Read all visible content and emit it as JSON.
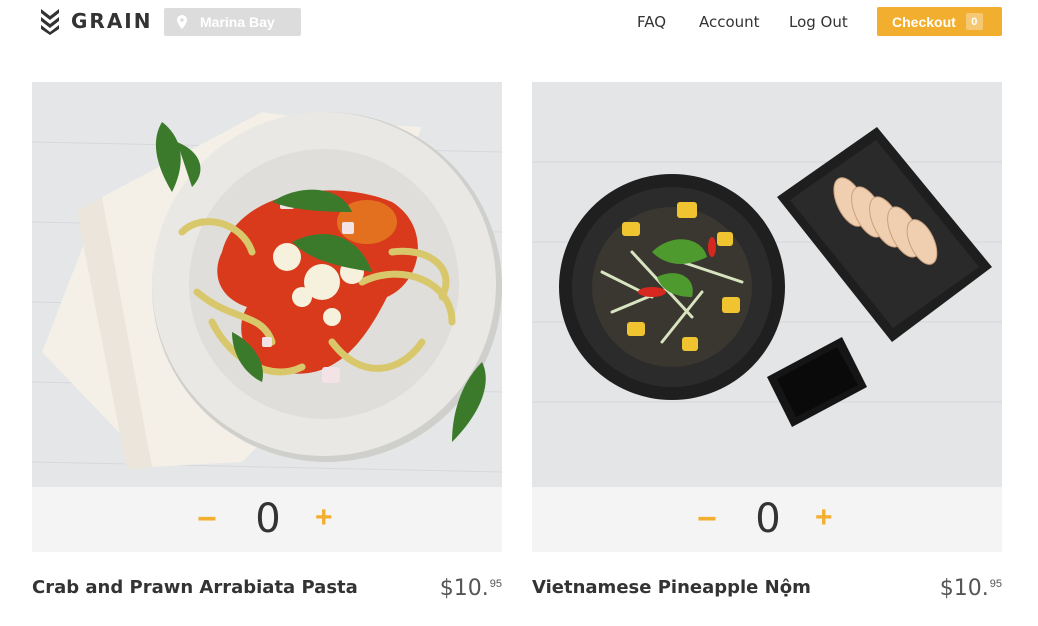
{
  "header": {
    "logo_text": "GRAIN",
    "location": "Marina Bay",
    "nav": {
      "faq": "FAQ",
      "account": "Account",
      "logout": "Log Out"
    },
    "checkout": {
      "label": "Checkout",
      "count": "0"
    }
  },
  "colors": {
    "accent": "#f2ae2e",
    "location_bg": "#dcdcdc",
    "qty_bar_bg": "#f4f4f4"
  },
  "products": [
    {
      "name": "Crab and Prawn Arrabiata Pasta",
      "quantity": "0",
      "minus": "−",
      "plus": "+",
      "price_main": "$10.",
      "price_cents": "95"
    },
    {
      "name": "Vietnamese Pineapple Nộm",
      "quantity": "0",
      "minus": "−",
      "plus": "+",
      "price_main": "$10.",
      "price_cents": "95"
    }
  ]
}
